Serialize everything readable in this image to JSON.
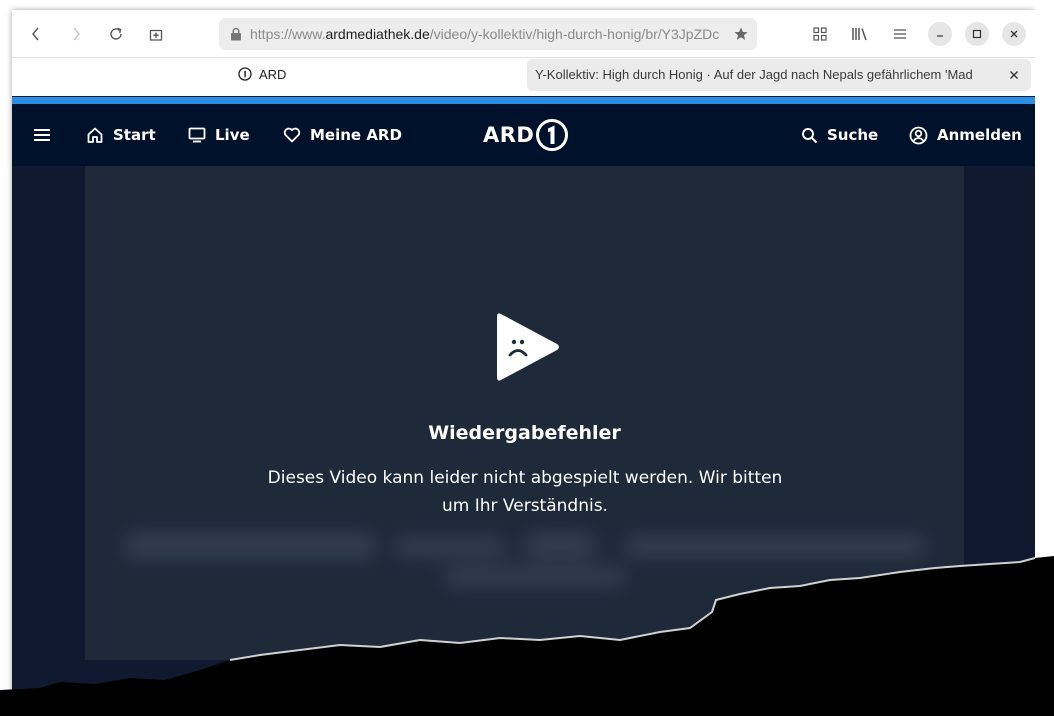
{
  "browser": {
    "url_prefix": "https://www.",
    "url_host": "ardmediathek.de",
    "url_path": "/video/y-kollektiv/high-durch-honig/br/Y3JpZDc",
    "pinned_tab_label": "ARD",
    "active_tab_title": "Y-Kollektiv: High durch Honig · Auf der Jagd nach Nepals gefährlichem 'Mad",
    "progress_color": "#2b8de4",
    "icons": [
      "back-icon",
      "forward-icon",
      "reload-icon",
      "new-tab-icon",
      "lock-icon",
      "star-icon",
      "grid-icon",
      "library-icon",
      "menu-icon",
      "minimize-icon",
      "maximize-icon",
      "close-icon"
    ]
  },
  "header": {
    "nav": {
      "start": "Start",
      "live": "Live",
      "meine_ard": "Meine ARD",
      "suche": "Suche",
      "anmelden": "Anmelden"
    },
    "logo_text": "ARD",
    "logo_mark": "1",
    "background": "#00112c"
  },
  "player": {
    "error_title": "Wiedergabefehler",
    "error_message": "Dieses Video kann leider nicht abgespielt werden. Wir bitten um Ihr Verständnis.",
    "background": "#1e293a",
    "icon": "sad-play-icon"
  }
}
